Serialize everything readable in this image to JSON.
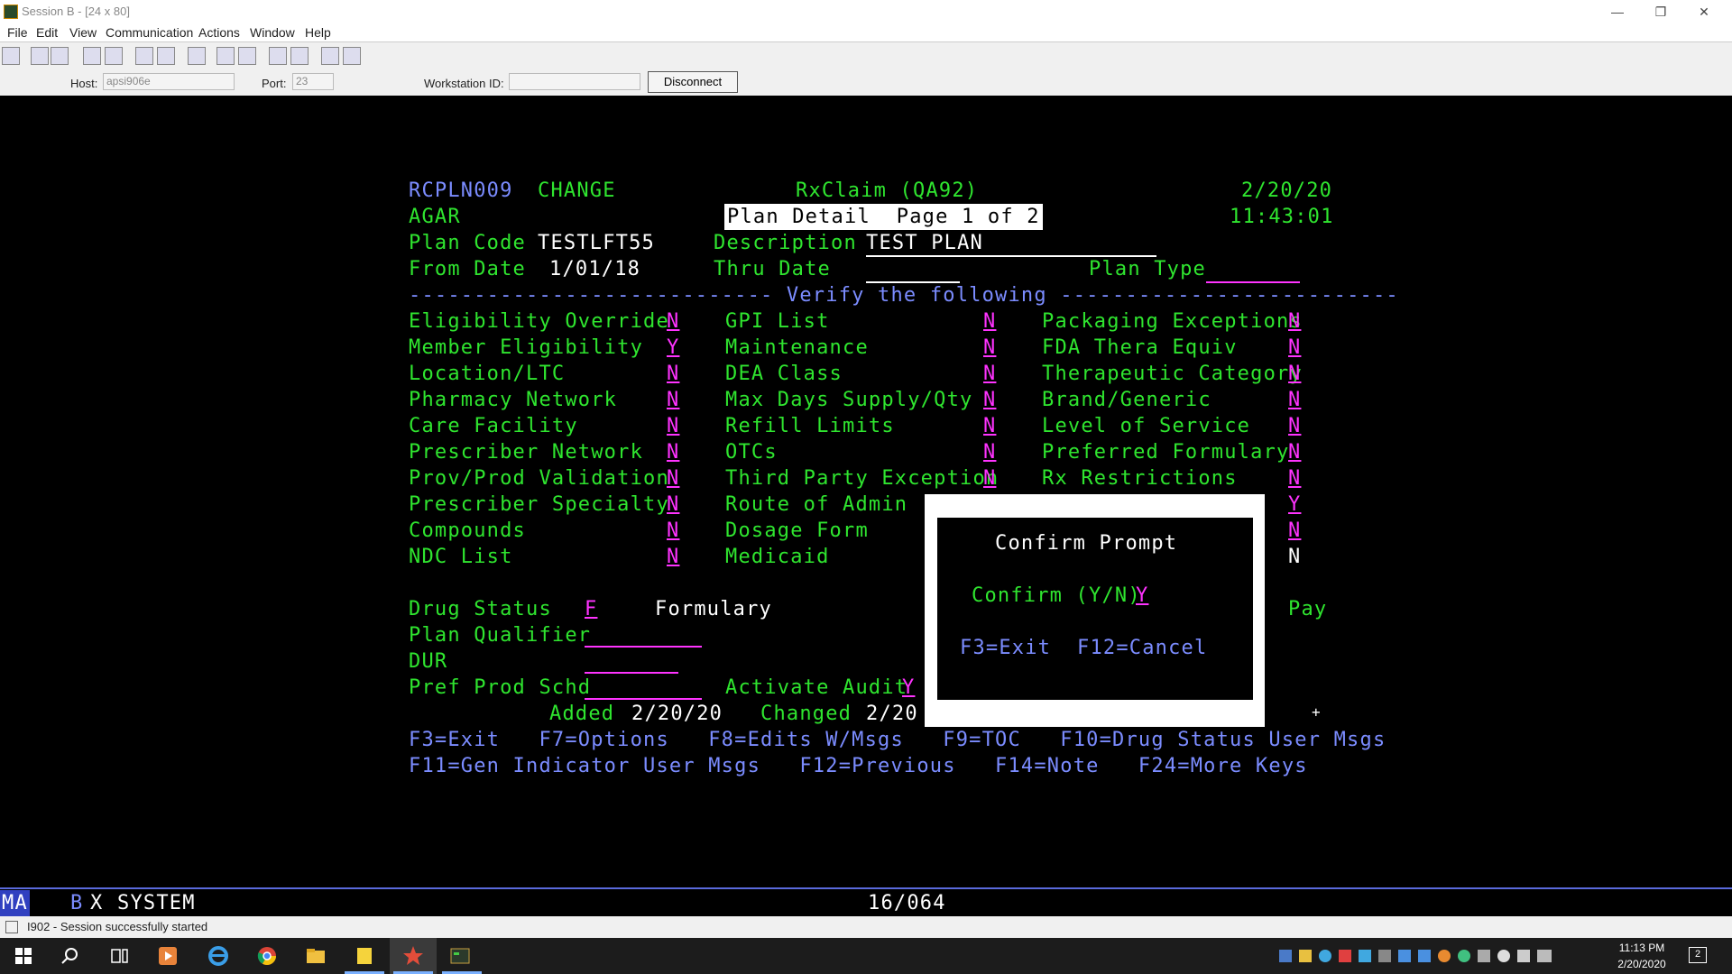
{
  "window": {
    "title": "Session B - [24 x 80]",
    "min": "—",
    "max": "❐",
    "close": "✕"
  },
  "menu": {
    "file": "File",
    "edit": "Edit",
    "view": "View",
    "communication": "Communication",
    "actions": "Actions",
    "window": "Window",
    "help": "Help"
  },
  "hostbar": {
    "host_label": "Host:",
    "host_value": "apsi906e",
    "port_label": "Port:",
    "port_value": "23",
    "ws_label": "Workstation ID:",
    "ws_value": "",
    "disconnect": "Disconnect"
  },
  "screen": {
    "program": "RCPLN009",
    "mode": "CHANGE",
    "system": "RxClaim (QA92)",
    "date": "2/20/20",
    "user": "AGAR",
    "title": "Plan Detail  Page 1 of 2",
    "time": "11:43:01",
    "plan_code_label": "Plan Code",
    "plan_code": "TESTLFT55",
    "description_label": "Description",
    "description": "TEST PLAN",
    "from_date_label": "From Date",
    "from_date": "1/01/18",
    "thru_date_label": "Thru Date",
    "thru_date": "",
    "plan_type_label": "Plan Type",
    "plan_type": "",
    "verify_left": "---------------------------- ",
    "verify_label": "Verify the following",
    "verify_right": " --------------------------",
    "col1": [
      {
        "label": "Eligibility Override",
        "value": "N"
      },
      {
        "label": "Member Eligibility",
        "value": "Y"
      },
      {
        "label": "Location/LTC",
        "value": "N"
      },
      {
        "label": "Pharmacy Network",
        "value": "N"
      },
      {
        "label": "Care Facility",
        "value": "N"
      },
      {
        "label": "Prescriber Network",
        "value": "N"
      },
      {
        "label": "Prov/Prod Validation",
        "value": "N"
      },
      {
        "label": "Prescriber Specialty",
        "value": "N"
      },
      {
        "label": "Compounds",
        "value": "N"
      },
      {
        "label": "NDC List",
        "value": "N"
      }
    ],
    "col2": [
      {
        "label": "GPI List",
        "value": "N"
      },
      {
        "label": "Maintenance",
        "value": "N"
      },
      {
        "label": "DEA Class",
        "value": "N"
      },
      {
        "label": "Max Days Supply/Qty",
        "value": "N"
      },
      {
        "label": "Refill Limits",
        "value": "N"
      },
      {
        "label": "OTCs",
        "value": "N"
      },
      {
        "label": "Third Party Exception",
        "value": "N"
      },
      {
        "label": "Route of Admin",
        "value": ""
      },
      {
        "label": "Dosage Form",
        "value": ""
      },
      {
        "label": "Medicaid",
        "value": ""
      }
    ],
    "col3": [
      {
        "label": "Packaging Exceptions",
        "value": "N"
      },
      {
        "label": "FDA Thera Equiv",
        "value": "N"
      },
      {
        "label": "Therapeutic Category",
        "value": "N"
      },
      {
        "label": "Brand/Generic",
        "value": "N"
      },
      {
        "label": "Level of Service",
        "value": "N"
      },
      {
        "label": "Preferred Formulary",
        "value": "N"
      },
      {
        "label": "Rx Restrictions",
        "value": "N"
      },
      {
        "label": "",
        "value": "Y"
      },
      {
        "label": "",
        "value": "N"
      },
      {
        "label": "",
        "value": "N"
      }
    ],
    "drug_status_label": "Drug Status",
    "drug_status": "F",
    "drug_status_desc": "Formulary",
    "pay": "Pay",
    "plan_qualifier_label": "Plan Qualifier",
    "dur_label": "DUR",
    "pref_prod_label": "Pref Prod Schd",
    "activate_audit_label": "Activate Audit",
    "activate_audit": "Y",
    "added_label": "Added",
    "added": "2/20/20",
    "changed_label": "Changed",
    "changed": "2/20",
    "plus": "+",
    "fkeys1": "F3=Exit   F7=Options   F8=Edits W/Msgs   F9=TOC   F10=Drug Status User Msgs",
    "fkeys2": "F11=Gen Indicator User Msgs   F12=Previous   F14=Note   F24=More Keys"
  },
  "popup": {
    "title": "Confirm Prompt",
    "confirm_label": "Confirm (Y/N)",
    "confirm_value": "Y",
    "f3": "F3=Exit",
    "f12": "F12=Cancel"
  },
  "oia": {
    "ma": "MA",
    "session": "B",
    "x": "X",
    "system": "SYSTEM",
    "cursor": "16/064"
  },
  "status": {
    "message": "I902 - Session successfully started"
  },
  "taskbar": {
    "time": "11:13 PM",
    "date": "2/20/2020",
    "notif_count": "2"
  }
}
